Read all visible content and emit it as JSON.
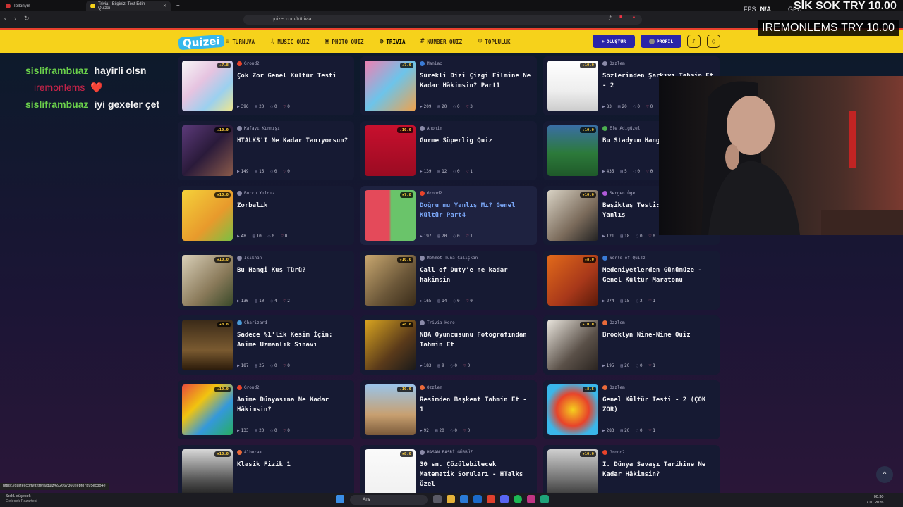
{
  "browser": {
    "tabs": [
      {
        "title": "Tellonym",
        "active": false
      },
      {
        "title": "Trivia - Bilginizi Test Edin - Quizei",
        "active": true
      }
    ],
    "url": "quizei.com/tr/trivia",
    "status_url": "https://quizei.com/tr/trivia/quiz/6926673602ebf87b95ec8b4e"
  },
  "stream_overlay": {
    "fps_label": "FPS",
    "fps_value": "N/A",
    "gpu_label": "GPU",
    "top_text": "SİK SOK  TRY 10.00",
    "donor_name": "IREMONLEMS",
    "donor_amount": "TRY 10.00"
  },
  "chat": [
    {
      "user": "sisliframbuaz",
      "message": "hayirli olsn",
      "user_color": "#6bd14b"
    },
    {
      "user": "iremonlems",
      "message": "❤️",
      "user_color": "#d0244a"
    },
    {
      "user": "sisliframbuaz",
      "message": "iyi gexeler çet",
      "user_color": "#6bd14b"
    }
  ],
  "site": {
    "logo": "Quizei",
    "nav": [
      {
        "label": "TURNUVA",
        "icon": "trophy-icon",
        "active": false
      },
      {
        "label": "MUSIC QUIZ",
        "icon": "music-icon",
        "active": false
      },
      {
        "label": "PHOTO QUIZ",
        "icon": "photo-icon",
        "active": false
      },
      {
        "label": "TRIVIA",
        "icon": "chat-icon",
        "active": true
      },
      {
        "label": "NUMBER QUIZ",
        "icon": "hash-icon",
        "active": false
      },
      {
        "label": "TOPLULUK",
        "icon": "people-icon",
        "active": false
      }
    ],
    "create_label": "OLUŞTUR",
    "profile_label": "PROFIL",
    "colors": {
      "header": "#f6d21b",
      "accent": "#2a24a8",
      "card": "#161a33"
    }
  },
  "quizzes": [
    {
      "author": "Grond2",
      "title": "Çok Zor Genel Kültür Testi",
      "rating": "7.8",
      "plays": "396",
      "questions": "20",
      "comments": "0",
      "likes": "0"
    },
    {
      "author": "Maniac",
      "title": "Sürekli Dizi Çizgi Filmine Ne Kadar Hâkimsin? Part1",
      "rating": "7.0",
      "plays": "209",
      "questions": "20",
      "comments": "0",
      "likes": "3"
    },
    {
      "author": "Ozzlem",
      "title": "Sözlerinden Şarkıyı Tahmin Et - 2",
      "rating": "10.0",
      "plays": "83",
      "questions": "20",
      "comments": "0",
      "likes": "0"
    },
    {
      "author": "Kafayı Kırmışı",
      "title": "HTALKS'I Ne Kadar Tanıyorsun?",
      "rating": "10.0",
      "plays": "149",
      "questions": "15",
      "comments": "0",
      "likes": "0"
    },
    {
      "author": "Anonim",
      "title": "Gurme Süperlig Quiz",
      "rating": "10.0",
      "plays": "139",
      "questions": "12",
      "comments": "0",
      "likes": "1"
    },
    {
      "author": "Efe Adıgüzel",
      "title": "Bu Stadyum Hangi Takıma Ait?",
      "rating": "10.0",
      "plays": "435",
      "questions": "5",
      "comments": "0",
      "likes": "0"
    },
    {
      "author": "Burcu Yıldız",
      "title": "Zorbalık",
      "rating": "10.0",
      "plays": "48",
      "questions": "10",
      "comments": "0",
      "likes": "0"
    },
    {
      "author": "Grond2",
      "title": "Doğru mu Yanlış Mı? Genel Kültür Part4",
      "rating": "7.8",
      "plays": "197",
      "questions": "20",
      "comments": "0",
      "likes": "1"
    },
    {
      "author": "Sergen Öge",
      "title": "Beşiktaş Testi: Doğru mu Yanlış",
      "rating": "10.0",
      "plays": "121",
      "questions": "18",
      "comments": "0",
      "likes": "0"
    },
    {
      "author": "Işıkhan",
      "title": "Bu Hangi Kuş Türü?",
      "rating": "10.0",
      "plays": "136",
      "questions": "10",
      "comments": "4",
      "likes": "2"
    },
    {
      "author": "Mehmet Tuna Çalışkan",
      "title": "Call of Duty'e ne kadar hakimsin",
      "rating": "10.0",
      "plays": "165",
      "questions": "14",
      "comments": "0",
      "likes": "0"
    },
    {
      "author": "World of Quizz",
      "title": "Medeniyetlerden Günümüze - Genel Kültür Maratonu",
      "rating": "8.0",
      "plays": "274",
      "questions": "15",
      "comments": "2",
      "likes": "1"
    },
    {
      "author": "Charizard",
      "title": "Sadece %1'lik Kesim İçin: Anime Uzmanlık Sınavı",
      "rating": "8.8",
      "plays": "187",
      "questions": "25",
      "comments": "0",
      "likes": "0"
    },
    {
      "author": "Trivia Hero",
      "title": "NBA Oyuncusunu Fotoğrafından Tahmin Et",
      "rating": "8.8",
      "plays": "183",
      "questions": "9",
      "comments": "0",
      "likes": "0"
    },
    {
      "author": "Ozzlem",
      "title": "Brooklyn Nine-Nine Quiz",
      "rating": "10.0",
      "plays": "195",
      "questions": "20",
      "comments": "0",
      "likes": "1"
    },
    {
      "author": "Grond2",
      "title": "Anime Dünyasına Ne Kadar Hâkimsin?",
      "rating": "10.0",
      "plays": "133",
      "questions": "20",
      "comments": "0",
      "likes": "0"
    },
    {
      "author": "Ozzlem",
      "title": "Resimden Başkent Tahmin Et - 1",
      "rating": "10.0",
      "plays": "92",
      "questions": "20",
      "comments": "0",
      "likes": "0"
    },
    {
      "author": "Ozzlem",
      "title": "Genel Kültür Testi - 2 (ÇOK ZOR)",
      "rating": "8.5",
      "plays": "283",
      "questions": "20",
      "comments": "0",
      "likes": "1"
    },
    {
      "author": "Alborak",
      "title": "Klasik Fizik 1",
      "rating": "10.0",
      "plays": "",
      "questions": "",
      "comments": "",
      "likes": ""
    },
    {
      "author": "HASAN BASRİ GÜRBÜZ",
      "title": "30 sn. Çözülebilecek Matematik Soruları - HTalks Özel",
      "rating": "8.0",
      "plays": "",
      "questions": "",
      "comments": "",
      "likes": ""
    },
    {
      "author": "Grond2",
      "title": "I. Dünya Savaşı Tarihine Ne Kadar Hâkimsin?",
      "rating": "10.0",
      "plays": "",
      "questions": "",
      "comments": "",
      "likes": ""
    }
  ],
  "taskbar": {
    "weather_line1": "Sıckl. düşecek",
    "weather_line2": "Gelecek Pazartesi",
    "search_placeholder": "Ara",
    "time": "00:30",
    "date": "7.01.2026"
  }
}
